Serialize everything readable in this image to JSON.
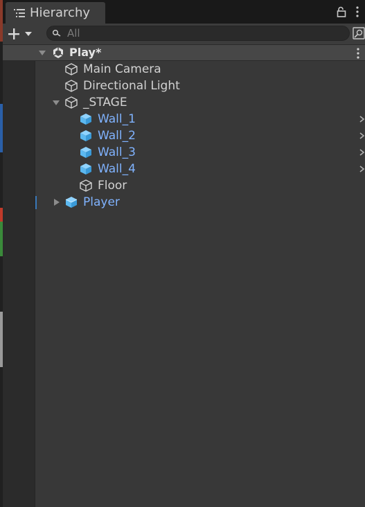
{
  "window": {
    "tab_title": "Hierarchy"
  },
  "search": {
    "placeholder": "All"
  },
  "scene": {
    "name": "Play*"
  },
  "tree": [
    {
      "label": "Main Camera",
      "type": "gameobject",
      "depth": 1
    },
    {
      "label": "Directional Light",
      "type": "gameobject",
      "depth": 1
    },
    {
      "label": "_STAGE",
      "type": "gameobject",
      "depth": 1,
      "expanded": true
    },
    {
      "label": "Wall_1",
      "type": "prefab",
      "depth": 2
    },
    {
      "label": "Wall_2",
      "type": "prefab",
      "depth": 2
    },
    {
      "label": "Wall_3",
      "type": "prefab",
      "depth": 2
    },
    {
      "label": "Wall_4",
      "type": "prefab",
      "depth": 2
    },
    {
      "label": "Floor",
      "type": "gameobject",
      "depth": 2
    },
    {
      "label": "Player",
      "type": "prefab",
      "depth": 1,
      "expanded": false
    }
  ],
  "colors": {
    "background": "#383838",
    "prefab_text": "#80b3ff",
    "prefab_icon": "#5cb8f0",
    "text": "#d2d2d2",
    "selection_marker": "#3a79bb"
  },
  "icons": {
    "tab": "list-icon",
    "lock": "lock-icon",
    "menu": "kebab-menu-icon",
    "add": "plus-icon",
    "search": "search-icon",
    "scene": "unity-scene-icon",
    "gameobject": "cube-outline-icon",
    "prefab": "prefab-cube-icon"
  }
}
